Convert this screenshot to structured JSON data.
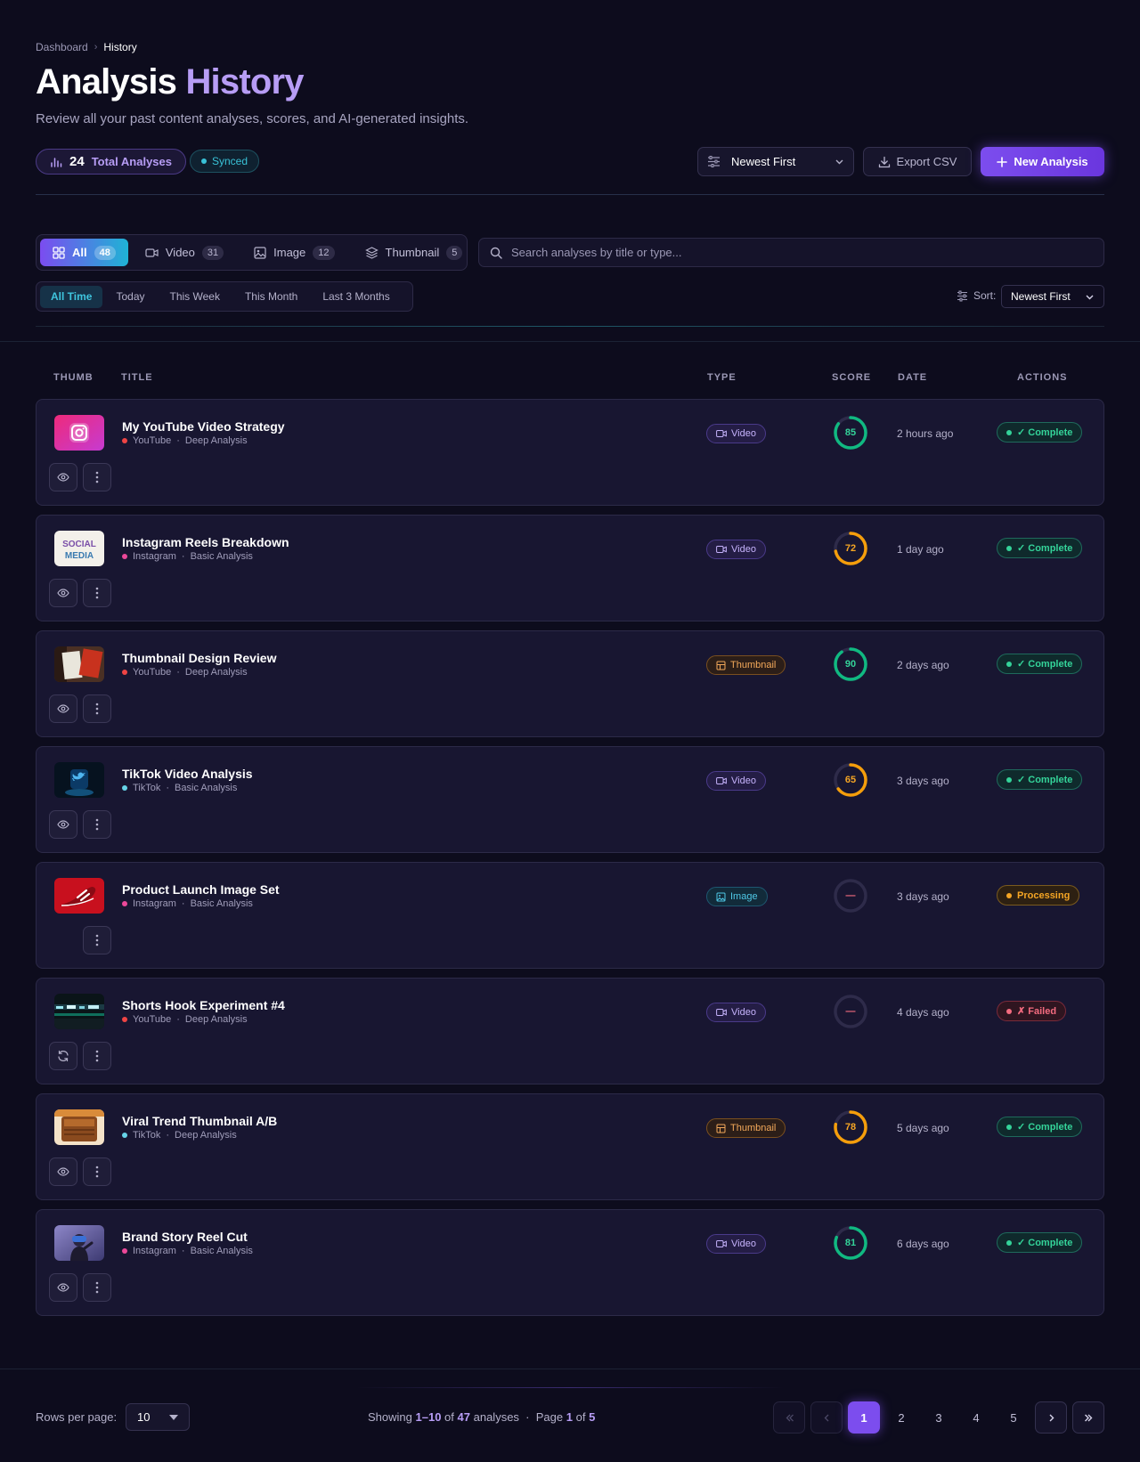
{
  "breadcrumb": {
    "home": "Dashboard",
    "separator": "›",
    "current": "History"
  },
  "header": {
    "title_main": "Analysis",
    "title_accent": "History",
    "subtitle": "Review all your past content analyses, scores, and AI-generated insights.",
    "total_count": "24",
    "total_label": "Total Analyses",
    "sync_status": "Synced",
    "sort_value": "Newest First",
    "export_label": "Export CSV",
    "new_label": "New Analysis"
  },
  "filters": {
    "tabs": [
      {
        "label": "All",
        "count": "48",
        "icon": "grid-icon"
      },
      {
        "label": "Video",
        "count": "31",
        "icon": "video-icon"
      },
      {
        "label": "Image",
        "count": "12",
        "icon": "image-icon"
      },
      {
        "label": "Thumbnail",
        "count": "5",
        "icon": "layers-icon"
      }
    ],
    "search_placeholder": "Search analyses by title or type...",
    "time_ranges": [
      "All Time",
      "Today",
      "This Week",
      "This Month",
      "Last 3 Months"
    ],
    "sort_label": "Sort:",
    "sort_value": "Newest First"
  },
  "table": {
    "columns": [
      "THUMB",
      "TITLE",
      "TYPE",
      "SCORE",
      "DATE",
      "ACTIONS"
    ],
    "rows": [
      {
        "title": "My YouTube Video Strategy",
        "platform": "YouTube",
        "depth": "Deep Analysis",
        "type": "Video",
        "score": "85",
        "date": "2 hours ago",
        "status": "✓ Complete"
      },
      {
        "title": "Instagram Reels Breakdown",
        "platform": "Instagram",
        "depth": "Basic Analysis",
        "type": "Video",
        "score": "72",
        "date": "1 day ago",
        "status": "✓ Complete"
      },
      {
        "title": "Thumbnail Design Review",
        "platform": "YouTube",
        "depth": "Deep Analysis",
        "type": "Thumbnail",
        "score": "90",
        "date": "2 days ago",
        "status": "✓ Complete"
      },
      {
        "title": "TikTok Video Analysis",
        "platform": "TikTok",
        "depth": "Basic Analysis",
        "type": "Video",
        "score": "65",
        "date": "3 days ago",
        "status": "✓ Complete"
      },
      {
        "title": "Product Launch Image Set",
        "platform": "Instagram",
        "depth": "Basic Analysis",
        "type": "Image",
        "score": "—",
        "date": "3 days ago",
        "status": "Processing"
      },
      {
        "title": "Shorts Hook Experiment #4",
        "platform": "YouTube",
        "depth": "Deep Analysis",
        "type": "Video",
        "score": "—",
        "date": "4 days ago",
        "status": "✗ Failed"
      },
      {
        "title": "Viral Trend Thumbnail A/B",
        "platform": "TikTok",
        "depth": "Deep Analysis",
        "type": "Thumbnail",
        "score": "78",
        "date": "5 days ago",
        "status": "✓ Complete"
      },
      {
        "title": "Brand Story Reel Cut",
        "platform": "Instagram",
        "depth": "Basic Analysis",
        "type": "Video",
        "score": "81",
        "date": "6 days ago",
        "status": "✓ Complete"
      }
    ]
  },
  "thumb_text": {
    "social_line1": "SOCIAL",
    "social_line2": "MEDIA"
  },
  "colors": {
    "accent": "#7c4dee",
    "complete": "#34d399",
    "processing": "#f5a524",
    "failed": "#f36b7f",
    "youtube": "#ef4444",
    "instagram": "#ec4899",
    "tiktok": "#67d4e8"
  },
  "pagination": {
    "rows_per_page_label": "Rows per page:",
    "rows_per_page": "10",
    "showing_prefix": "Showing",
    "range": "1–10",
    "of1": "of",
    "total": "47",
    "noun": "analyses",
    "sep": "·",
    "page_word": "Page",
    "page": "1",
    "of2": "of",
    "pages": "5",
    "page_numbers": [
      "1",
      "2",
      "3",
      "4",
      "5"
    ]
  }
}
